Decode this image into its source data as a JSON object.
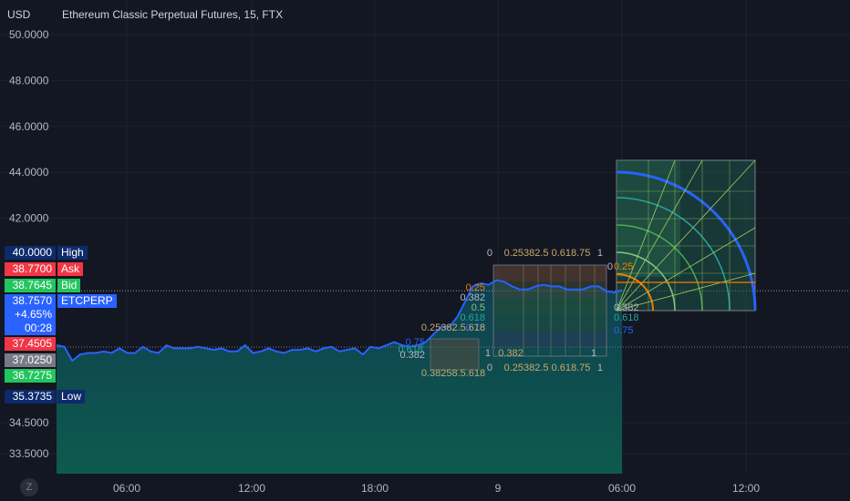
{
  "header": {
    "currency": "USD",
    "title": "Ethereum Classic Perpetual Futures, 15, FTX"
  },
  "price_tags": [
    {
      "label": "High",
      "value": "40.0000",
      "bg": "#0d2a6b",
      "name_bg": "#0d2a6b"
    },
    {
      "label": "Ask",
      "value": "38.7700",
      "bg": "#f23645",
      "name_bg": "#f23645"
    },
    {
      "label": "Bid",
      "value": "38.7645",
      "bg": "#22c55e",
      "name_bg": "#22c55e"
    },
    {
      "label": "ETCPERP",
      "value": "38.7570",
      "bg": "#2962ff",
      "name_bg": "#2962ff"
    },
    {
      "label": "",
      "value": "37.4505",
      "bg": "#f23645",
      "name_bg": ""
    },
    {
      "label": "",
      "value": "37.0250",
      "bg": "#787b86",
      "name_bg": ""
    },
    {
      "label": "",
      "value": "36.7275",
      "bg": "#22c55e",
      "name_bg": ""
    },
    {
      "label": "Low",
      "value": "35.3735",
      "bg": "#0d2a6b",
      "name_bg": "#0d2a6b"
    }
  ],
  "price_change": {
    "percent": "+4.65%",
    "countdown": "00:28"
  },
  "zoom_button": "Z",
  "colors": {
    "background": "#131722",
    "line": "#2962ff",
    "area_fill": "#0f4a4a",
    "grid": "#1e222d",
    "axis_text": "#b2b5be"
  },
  "chart_data": {
    "type": "area",
    "title": "Ethereum Classic Perpetual Futures, 15, FTX",
    "ylabel": "USD",
    "ylim": [
      32.7,
      50.3
    ],
    "y_ticks": [
      "50.0000",
      "48.0000",
      "46.0000",
      "44.0000",
      "42.0000",
      "34.5000",
      "33.5000"
    ],
    "x_ticks": [
      "06:00",
      "12:00",
      "18:00",
      "9",
      "06:00",
      "12:00"
    ],
    "x_time_range_hours": [
      0,
      44
    ],
    "series": [
      {
        "name": "ETCPERP",
        "values": [
          [
            0.0,
            37.0
          ],
          [
            0.5,
            36.95
          ],
          [
            1.0,
            36.5
          ],
          [
            1.5,
            36.7
          ],
          [
            2.0,
            36.75
          ],
          [
            2.5,
            36.75
          ],
          [
            3.0,
            36.8
          ],
          [
            3.5,
            36.75
          ],
          [
            4.0,
            36.9
          ],
          [
            4.5,
            36.75
          ],
          [
            5.0,
            36.75
          ],
          [
            5.5,
            36.95
          ],
          [
            6.0,
            36.8
          ],
          [
            6.5,
            36.75
          ],
          [
            7.0,
            37.0
          ],
          [
            7.5,
            36.9
          ],
          [
            8.0,
            36.9
          ],
          [
            8.5,
            36.9
          ],
          [
            9.0,
            36.95
          ],
          [
            9.5,
            36.9
          ],
          [
            10.0,
            36.85
          ],
          [
            10.5,
            36.9
          ],
          [
            11.0,
            36.8
          ],
          [
            11.5,
            36.8
          ],
          [
            12.0,
            37.0
          ],
          [
            12.5,
            36.75
          ],
          [
            13.0,
            36.8
          ],
          [
            13.5,
            36.9
          ],
          [
            14.0,
            36.8
          ],
          [
            14.5,
            36.75
          ],
          [
            15.0,
            36.85
          ],
          [
            15.5,
            36.85
          ],
          [
            16.0,
            36.9
          ],
          [
            16.5,
            36.8
          ],
          [
            17.0,
            36.9
          ],
          [
            17.5,
            36.95
          ],
          [
            18.0,
            36.8
          ],
          [
            18.5,
            36.85
          ],
          [
            19.0,
            36.9
          ],
          [
            19.5,
            36.7
          ],
          [
            20.0,
            36.95
          ],
          [
            20.5,
            36.9
          ],
          [
            21.0,
            37.0
          ],
          [
            21.5,
            37.1
          ],
          [
            22.0,
            37.0
          ],
          [
            22.5,
            36.95
          ],
          [
            23.0,
            37.0
          ],
          [
            23.5,
            37.1
          ],
          [
            24.0,
            37.35
          ],
          [
            24.5,
            37.6
          ],
          [
            25.0,
            37.6
          ],
          [
            25.5,
            37.9
          ],
          [
            26.0,
            38.4
          ],
          [
            26.5,
            38.9
          ],
          [
            27.0,
            39.0
          ],
          [
            27.5,
            38.95
          ],
          [
            28.0,
            39.1
          ],
          [
            28.5,
            39.05
          ],
          [
            29.0,
            38.9
          ],
          [
            29.5,
            38.8
          ],
          [
            30.0,
            38.8
          ],
          [
            30.5,
            38.9
          ],
          [
            31.0,
            38.95
          ],
          [
            31.5,
            38.9
          ],
          [
            32.0,
            38.9
          ],
          [
            32.5,
            38.8
          ],
          [
            33.0,
            38.8
          ],
          [
            33.5,
            38.8
          ],
          [
            34.0,
            38.9
          ],
          [
            34.5,
            38.9
          ],
          [
            35.0,
            38.75
          ],
          [
            35.5,
            38.7
          ],
          [
            36.0,
            38.78
          ]
        ]
      }
    ],
    "extra_raw_points_note": "",
    "annotations": {
      "fib_levels": [
        "0",
        "0.25",
        "0.382",
        "0.5",
        "0.618",
        "0.75",
        "1"
      ],
      "levels_text_top": "0.25382.5 0.618.75",
      "levels_text_small": "0.382",
      "levels_text_small_combo": "0.25382.5.618",
      "levels_text_bottom_small": "0.38258.5.618"
    }
  }
}
